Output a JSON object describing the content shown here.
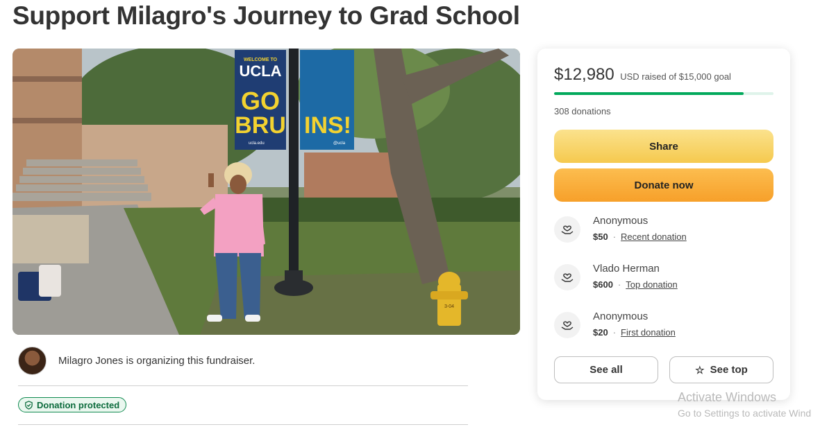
{
  "page": {
    "title": "Support Milagro's Journey to Grad School"
  },
  "hero_image": {
    "banner_left": {
      "top": "WELCOME TO",
      "main": "UCLA",
      "slogan_1": "GO",
      "slogan_2": "BRU",
      "footer": "ucla.edu"
    },
    "banner_right": {
      "slogan": "INS!",
      "footer": "@ucla"
    },
    "hydrant_label": "3-04"
  },
  "organizer": {
    "text": "Milagro Jones is organizing this fundraiser."
  },
  "badge": {
    "label": "Donation protected"
  },
  "donation": {
    "amount": "$12,980",
    "goal_text": "USD raised of $15,000 goal",
    "progress_fraction": 0.8653,
    "count_text": "308 donations",
    "share_label": "Share",
    "donate_label": "Donate now",
    "donors": [
      {
        "name": "Anonymous",
        "amount": "$50",
        "tag": "Recent donation"
      },
      {
        "name": "Vlado Herman",
        "amount": "$600",
        "tag": "Top donation"
      },
      {
        "name": "Anonymous",
        "amount": "$20",
        "tag": "First donation"
      }
    ],
    "see_all_label": "See all",
    "see_top_label": "See top"
  },
  "colors": {
    "progress": "#02a95c",
    "share_button": "#f5c94e",
    "donate_button": "#f7a02a",
    "protected_green": "#0f8a4f"
  },
  "icons": {
    "donor": "hand-heart-icon",
    "badge": "shield-check-icon",
    "see_top": "star-icon"
  },
  "os_watermark": {
    "line1": "Activate Windows",
    "line2": "Go to Settings to activate Wind"
  }
}
